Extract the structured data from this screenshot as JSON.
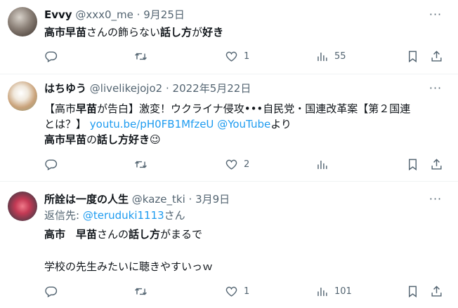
{
  "tweets": [
    {
      "display_name": "Evvy",
      "handle": "@xxx0_me",
      "dot": "·",
      "date": "9月25日",
      "text": [
        "高市早苗",
        "さんの飾らない",
        "話し方",
        "が",
        "好き"
      ],
      "reply_count": "",
      "retweet_count": "",
      "like_count": "1",
      "view_count": "55"
    },
    {
      "display_name": "はちゆう",
      "handle": "@livelikejojo2",
      "dot": "·",
      "date": "2022年5月22日",
      "line1": [
        "【高市",
        "早苗",
        "が告白】激変！ウクライナ侵攻•••自民党・国連改革案【第２国連"
      ],
      "line2": [
        "とは？】 ",
        "youtu.be/pH0FB1MfzeU",
        " ",
        "@YouTube",
        "より"
      ],
      "line3": [
        "高市早苗",
        "の",
        "話し方好き",
        "😉"
      ],
      "reply_count": "",
      "retweet_count": "",
      "like_count": "2",
      "view_count": ""
    },
    {
      "display_name": "所詮は一度の人生",
      "handle": "@kaze_tki",
      "dot": "·",
      "date": "3月9日",
      "reply_prefix": "返信先: ",
      "reply_to": "@teruduki1113",
      "reply_suffix": "さん",
      "line1": [
        "高市　早苗",
        "さんの",
        "話し方",
        "がまるで"
      ],
      "line2": "学校の先生みたいに聴きやすいっｗ",
      "reply_count": "",
      "retweet_count": "",
      "like_count": "1",
      "view_count": "101"
    }
  ],
  "icons": {
    "reply": "reply-icon",
    "retweet": "retweet-icon",
    "like": "heart-icon",
    "views": "views-icon",
    "bookmark": "bookmark-icon",
    "share": "share-icon",
    "more": "more-icon"
  },
  "colors": {
    "text": "#0f1419",
    "secondary": "#536471",
    "link": "#1d9bf0",
    "separator": "#eff3f4"
  }
}
